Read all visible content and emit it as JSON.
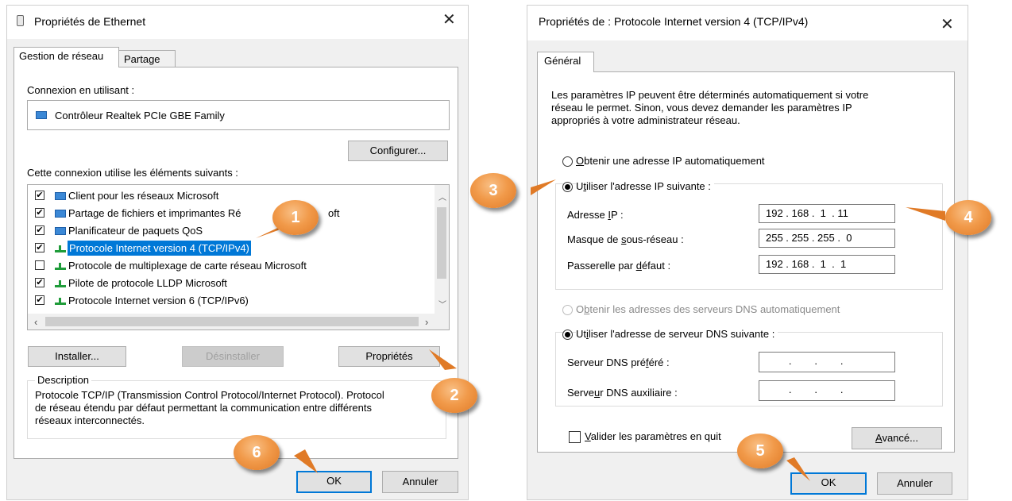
{
  "left": {
    "title": "Propriétés de Ethernet",
    "tabs": [
      "Gestion de réseau",
      "Partage"
    ],
    "connect_using_label": "Connexion en utilisant :",
    "adapter_name": "Contrôleur Realtek PCIe GBE Family",
    "configure_button": "Configurer...",
    "items_label": "Cette connexion utilise les éléments suivants :",
    "items": [
      {
        "label": "Client pour les réseaux Microsoft",
        "checked": true,
        "icon": "network-client-icon"
      },
      {
        "label": "Partage de fichiers et imprimantes Ré",
        "label_tail": "oft",
        "checked": true,
        "icon": "file-sharing-icon"
      },
      {
        "label": "Planificateur de paquets QoS",
        "checked": true,
        "icon": "qos-icon"
      },
      {
        "label": "Protocole Internet version 4 (TCP/IPv4)",
        "checked": true,
        "selected": true,
        "icon": "protocol-icon"
      },
      {
        "label": "Protocole de multiplexage de carte réseau Microsoft",
        "checked": false,
        "icon": "protocol-icon"
      },
      {
        "label": "Pilote de protocole LLDP Microsoft",
        "checked": true,
        "icon": "protocol-icon"
      },
      {
        "label": "Protocole Internet version 6 (TCP/IPv6)",
        "checked": true,
        "icon": "protocol-icon"
      }
    ],
    "install_button": "Installer...",
    "uninstall_button": "Désinstaller",
    "properties_button": "Propriétés",
    "description_label": "Description",
    "description_lines": [
      "Protocole TCP/IP (Transmission Control Protocol/Internet Protocol). Protocol",
      "de réseau étendu par défaut permettant la communication entre différents",
      "réseaux interconnectés."
    ],
    "ok_button": "OK",
    "cancel_button": "Annuler"
  },
  "right": {
    "title": "Propriétés de : Protocole Internet version 4 (TCP/IPv4)",
    "tab": "Général",
    "intro_lines": [
      "Les paramètres IP peuvent être déterminés automatiquement si votre",
      "réseau le permet. Sinon, vous devez demander les paramètres IP",
      "appropriés à votre administrateur réseau."
    ],
    "auto_ip": {
      "u": "O",
      "rest": "btenir une adresse IP automatiquement"
    },
    "manual_ip": {
      "pre": "U",
      "u": "t",
      "rest": "iliser l'adresse IP suivante :"
    },
    "ip_label": {
      "pre": "Adresse ",
      "u": "I",
      "rest": "P :"
    },
    "mask_label": {
      "pre": "Masque de ",
      "u": "s",
      "rest": "ous-réseau :"
    },
    "gateway_label": {
      "pre": "Passerelle par ",
      "u": "d",
      "rest": "éfaut :"
    },
    "ip_value": "192 . 168 .  1  . 11",
    "mask_value": "255 . 255 . 255 .  0",
    "gateway_value": "192 . 168 .  1  .  1",
    "auto_dns": {
      "pre": "O",
      "u": "b",
      "rest": "tenir les adresses des serveurs DNS automatiquement"
    },
    "manual_dns": {
      "pre": "Ut",
      "u": "i",
      "rest": "liser l'adresse de serveur DNS suivante :"
    },
    "preferred_dns_label": {
      "pre": "Serveur DNS pré",
      "u": "f",
      "rest": "éré :"
    },
    "alternate_dns_label": {
      "pre": "Serve",
      "u": "u",
      "rest": "r DNS auxiliaire :"
    },
    "empty_ip": "        .        .        .",
    "validate": {
      "u": "V",
      "rest": "alider les paramètres en quit"
    },
    "advanced_button": {
      "u": "A",
      "rest": "vancé..."
    },
    "ok_button": "OK",
    "cancel_button": "Annuler"
  },
  "callouts": [
    "1",
    "2",
    "3",
    "4",
    "5",
    "6"
  ],
  "colors": {
    "selection": "#0078d7",
    "callout": "#f19a4a",
    "button_border_default": "#0078d7"
  }
}
